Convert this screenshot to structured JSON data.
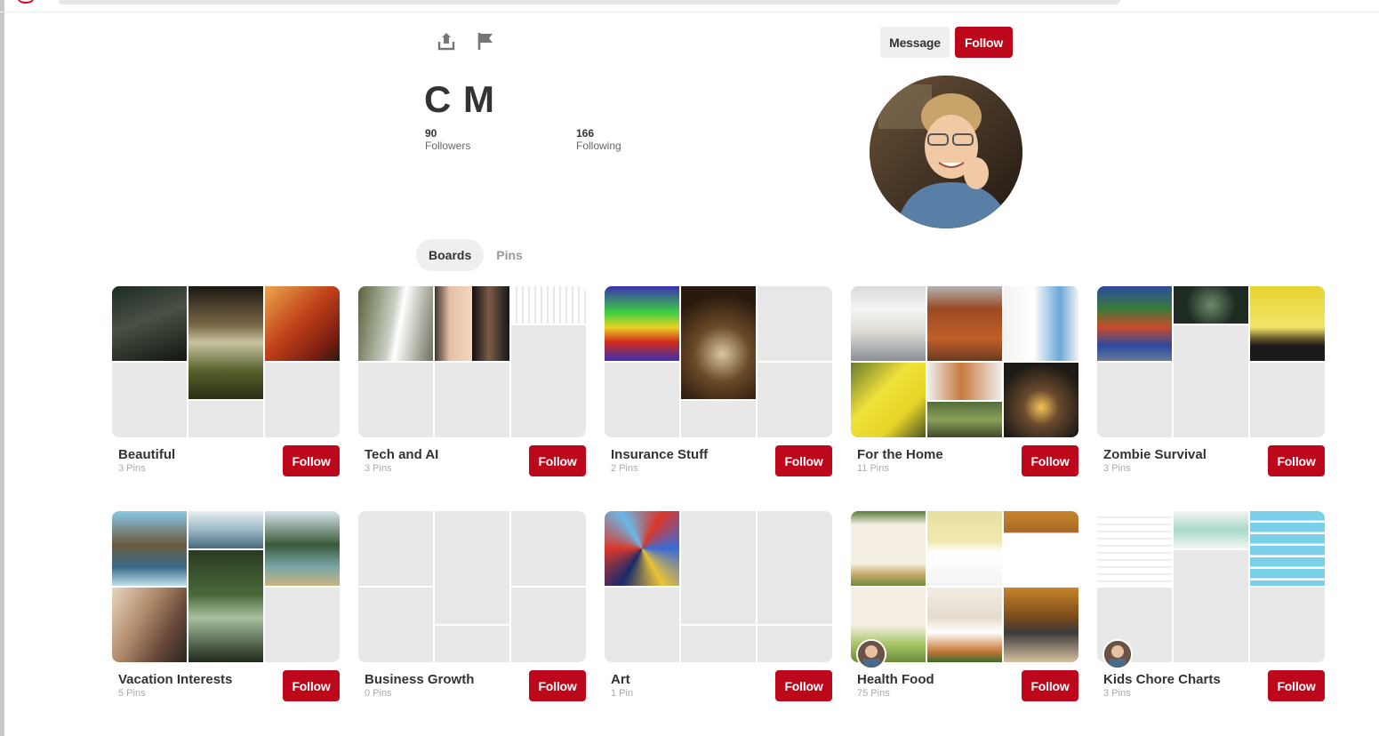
{
  "colors": {
    "accent": "#bd081c",
    "tile": "#e8e8e8",
    "pill": "#efefef"
  },
  "icons": {
    "share": "share-upload-icon",
    "flag": "flag-icon"
  },
  "profile": {
    "name": "C M",
    "followers_count": "90",
    "followers_label": "Followers",
    "following_count": "166",
    "following_label": "Following"
  },
  "actions": {
    "message_label": "Message",
    "follow_label": "Follow"
  },
  "tabs": [
    {
      "label": "Boards",
      "active": true
    },
    {
      "label": "Pins",
      "active": false
    }
  ],
  "boards": [
    {
      "title": "Beautiful",
      "pins": "3 Pins",
      "follow": "Follow"
    },
    {
      "title": "Tech and AI",
      "pins": "3 Pins",
      "follow": "Follow"
    },
    {
      "title": "Insurance Stuff",
      "pins": "2 Pins",
      "follow": "Follow"
    },
    {
      "title": "For the Home",
      "pins": "11 Pins",
      "follow": "Follow"
    },
    {
      "title": "Zombie Survival",
      "pins": "3 Pins",
      "follow": "Follow"
    },
    {
      "title": "Vacation Interests",
      "pins": "5 Pins",
      "follow": "Follow"
    },
    {
      "title": "Business Growth",
      "pins": "0 Pins",
      "follow": "Follow"
    },
    {
      "title": "Art",
      "pins": "1 Pin",
      "follow": "Follow"
    },
    {
      "title": "Health Food",
      "pins": "75 Pins",
      "follow": "Follow"
    },
    {
      "title": "Kids Chore Charts",
      "pins": "3 Pins",
      "follow": "Follow"
    }
  ]
}
